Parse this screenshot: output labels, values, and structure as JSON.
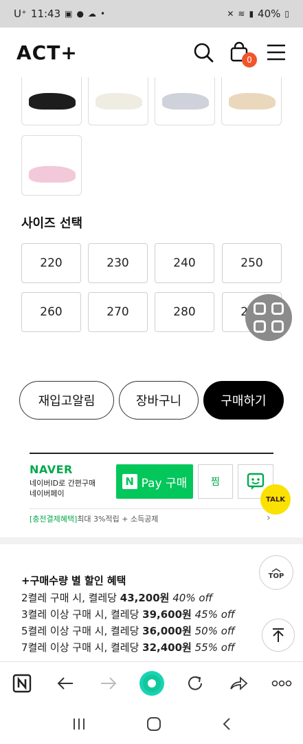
{
  "status_bar": {
    "carrier": "U⁺",
    "time": "11:43",
    "battery": "40%"
  },
  "header": {
    "logo": "ACT+",
    "cart_count": "0"
  },
  "colors": {
    "swatches": [
      "#1d1d1d",
      "#efece2",
      "#cfd2da",
      "#ead8bd",
      "#f3c8d8"
    ],
    "accent": "#000000",
    "naver_green": "#03c75a",
    "cart_badge": "#f0552b"
  },
  "size_section": {
    "title": "사이즈 선택",
    "sizes": [
      "220",
      "230",
      "240",
      "250",
      "260",
      "270",
      "280",
      "290"
    ]
  },
  "actions": {
    "restock": "재입고알림",
    "cart": "장바구니",
    "buy": "구매하기"
  },
  "naver_pay": {
    "brand": "NAVER",
    "sub_line1": "네이버ID로 간편구매",
    "sub_line2": "네이버페이",
    "buy_label": "Pay 구매",
    "zzim_label": "찜",
    "benefit_tag": "[충전결제혜택]",
    "benefit_text": "최대 3%적립 + 소득공제",
    "kakao_label": "TALK"
  },
  "discount": {
    "title": "+구매수량 별 할인 혜택",
    "lines": [
      {
        "prefix": "2켤레 구매 시, 켤레당 ",
        "price": "43,200원",
        "off": "40% off"
      },
      {
        "prefix": "3켤레 이상 구매 시, 켤레당 ",
        "price": "39,600원",
        "off": "45% off"
      },
      {
        "prefix": "5켤레 이상 구매 시, 켤레당 ",
        "price": "36,000원",
        "off": "50% off"
      },
      {
        "prefix": "7켤레 이상 구매 시, 켤레당 ",
        "price": "32,400원",
        "off": "55% off"
      }
    ]
  },
  "top_button": "TOP"
}
